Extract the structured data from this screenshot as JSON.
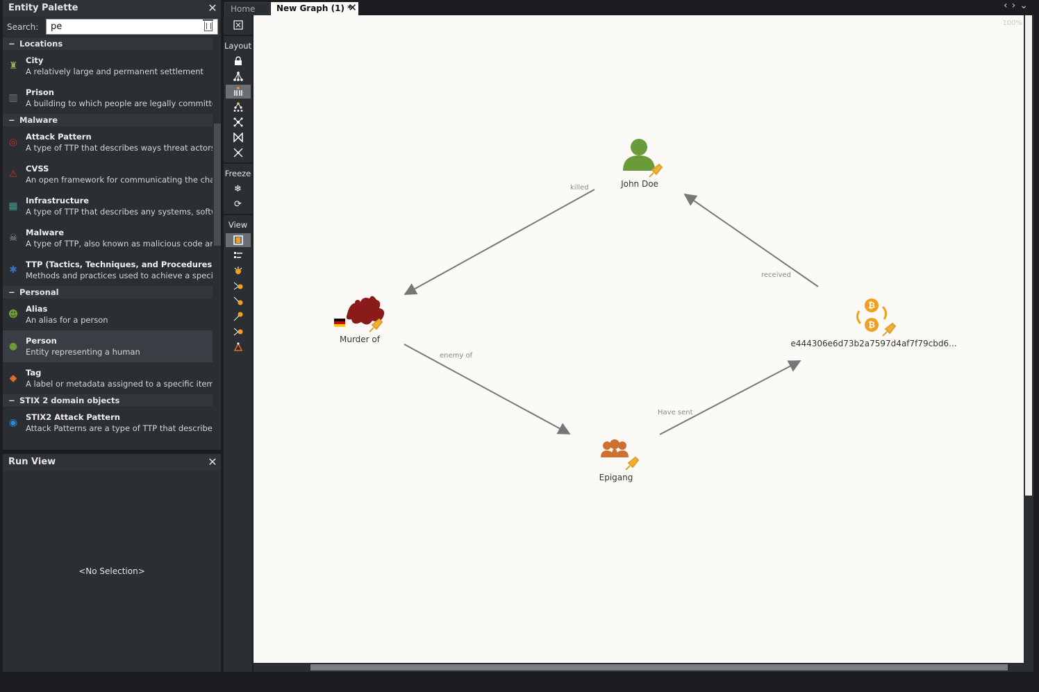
{
  "palette": {
    "title": "Entity Palette",
    "search_label": "Search:",
    "search_value": "pe",
    "categories": [
      {
        "label": "Locations",
        "items": [
          {
            "name": "City",
            "desc": "A relatively large and permanent settlement",
            "icon": "city-icon",
            "color": "#8fb04a"
          },
          {
            "name": "Prison",
            "desc": "A building to which people are legally committed as",
            "icon": "prison-icon",
            "color": "#777777"
          }
        ]
      },
      {
        "label": "Malware",
        "items": [
          {
            "name": "Attack Pattern",
            "desc": "A type of TTP that describes ways threat actors atte",
            "icon": "target-icon",
            "color": "#c0302a"
          },
          {
            "name": "CVSS",
            "desc": "An open framework for communicating the charact",
            "icon": "cvss-icon",
            "color": "#c0302a"
          },
          {
            "name": "Infrastructure",
            "desc": "A type of TTP that describes any systems, software s",
            "icon": "network-icon",
            "color": "#3aa08a"
          },
          {
            "name": "Malware",
            "desc": "A type of TTP, also known as malicious code and ma",
            "icon": "skull-icon",
            "color": "#9a9a9a"
          },
          {
            "name": "TTP (Tactics, Techniques, and Procedures)",
            "desc": "Methods and practices used to achieve a specific ob",
            "icon": "gear-icon",
            "color": "#3b6fc4"
          }
        ]
      },
      {
        "label": "Personal",
        "items": [
          {
            "name": "Alias",
            "desc": "An alias for a person",
            "icon": "alias-icon",
            "color": "#6a9a3a"
          },
          {
            "name": "Person",
            "desc": "Entity representing a human",
            "icon": "person-icon",
            "color": "#6a9a3a",
            "selected": true
          },
          {
            "name": "Tag",
            "desc": "A label or metadata assigned to a specific item or co",
            "icon": "tag-icon",
            "color": "#e06a2a"
          }
        ]
      },
      {
        "label": "STIX 2 domain objects",
        "items": [
          {
            "name": "STIX2 Attack Pattern",
            "desc": "Attack Patterns are a type of TTP that describe ways",
            "icon": "stix-icon",
            "color": "#2a8ae0"
          }
        ]
      }
    ]
  },
  "runview": {
    "title": "Run View",
    "empty_text": "<No Selection>"
  },
  "toolbar": {
    "layout_label": "Layout",
    "freeze_label": "Freeze",
    "view_label": "View"
  },
  "tabs": {
    "home": "Home",
    "graph": "New Graph (1) *"
  },
  "canvas": {
    "zoom": "100%",
    "nodes": [
      {
        "id": "john",
        "label": "John Doe",
        "icon": "person-icon",
        "color": "#6a9a3a"
      },
      {
        "id": "murder",
        "label": "Murder of",
        "icon": "murder-icon",
        "color": "#8b1a1a"
      },
      {
        "id": "epigang",
        "label": "Epigang",
        "icon": "group-icon",
        "color": "#d07030"
      },
      {
        "id": "btc",
        "label": "e444306e6d73b2a7597d4af7f79cbd6...",
        "icon": "bitcoin-icon",
        "color": "#f0a020"
      }
    ],
    "edges": [
      {
        "from": "john",
        "to": "murder",
        "label": "killed"
      },
      {
        "from": "murder",
        "to": "epigang",
        "label": "enemy of"
      },
      {
        "from": "epigang",
        "to": "btc",
        "label": "Have sent"
      },
      {
        "from": "btc",
        "to": "john",
        "label": "received"
      }
    ]
  }
}
